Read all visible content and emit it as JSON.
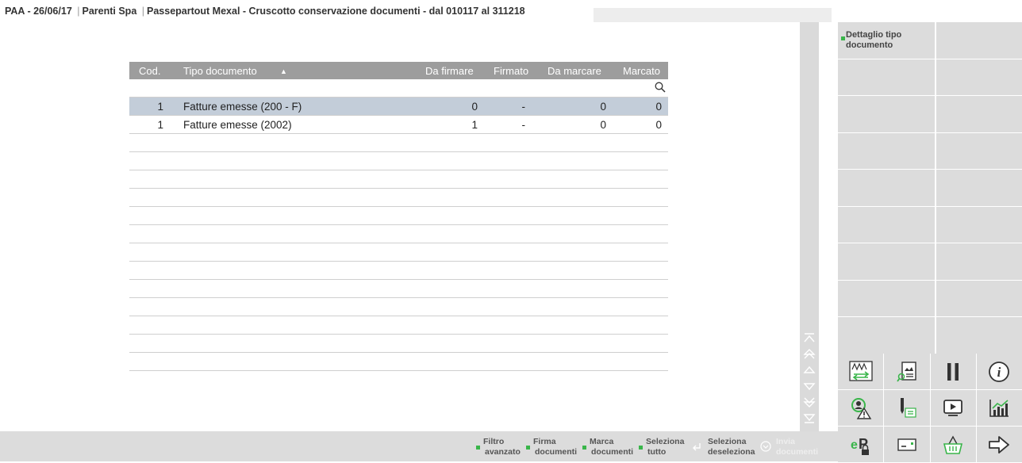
{
  "title": {
    "app": "PAA - 26/06/17",
    "company": "Parenti Spa",
    "module": "Passepartout Mexal - Cruscotto conservazione documenti - dal 010117 al 311218"
  },
  "table": {
    "headers": {
      "cod": "Cod.",
      "tipo": "Tipo documento",
      "sort_arrow": "▲",
      "da_firmare": "Da firmare",
      "firmato": "Firmato",
      "da_marcare": "Da marcare",
      "marcato": "Marcato"
    },
    "search_value": "",
    "rows": [
      {
        "cod": "1",
        "tipo": "Fatture emesse (200 - F)",
        "da_firmare": "0",
        "firmato": "-",
        "da_marcare": "0",
        "marcato": "0"
      },
      {
        "cod": "1",
        "tipo": "Fatture emesse (2002)",
        "da_firmare": "1",
        "firmato": "-",
        "da_marcare": "0",
        "marcato": "0"
      }
    ]
  },
  "right_panel": {
    "detail_button_line1": "Dettaglio tipo",
    "detail_button_line2": "documento"
  },
  "bottom_bar": {
    "filtro_l1": "Filtro",
    "filtro_l2": "avanzato",
    "firma_l1": "Firma",
    "firma_l2": "documenti",
    "marca_l1": "Marca",
    "marca_l2": "documenti",
    "sel_tutto_l1": "Seleziona",
    "sel_tutto_l2": "tutto",
    "sel_desel_l1": "Seleziona",
    "sel_desel_l2": "deseleziona",
    "invia_l1": "Invia",
    "invia_l2": "documenti"
  },
  "colors": {
    "accent_green": "#39b54a",
    "header_grey": "#9d9d9d",
    "selected_row": "#c3cdd9",
    "panel_grey": "#dcdcdc"
  }
}
